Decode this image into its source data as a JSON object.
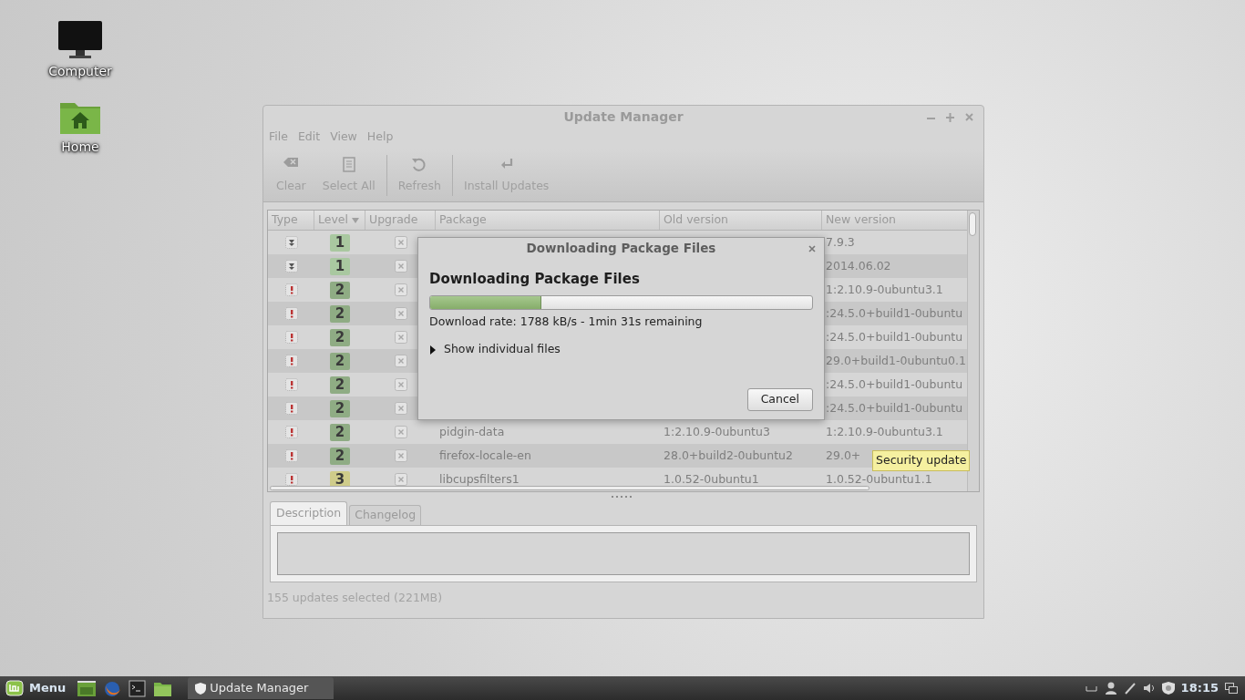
{
  "desktop_icons": [
    {
      "label": "Computer",
      "kind": "computer"
    },
    {
      "label": "Home",
      "kind": "home"
    }
  ],
  "window": {
    "title": "Update Manager"
  },
  "menu": [
    "File",
    "Edit",
    "View",
    "Help"
  ],
  "toolbar": [
    {
      "label": "Clear",
      "kind": "clear"
    },
    {
      "label": "Select All",
      "kind": "select"
    },
    {
      "label": "Refresh",
      "kind": "refresh"
    },
    {
      "label": "Install Updates",
      "kind": "install"
    }
  ],
  "table": {
    "columns": [
      "Type",
      "Level",
      "Upgrade",
      "Package",
      "Old version",
      "New version"
    ],
    "rows": [
      {
        "kind": "package",
        "level": "1",
        "checked": false,
        "new": "7.9.3"
      },
      {
        "kind": "package",
        "level": "1",
        "checked": false,
        "new": "2014.06.02"
      },
      {
        "kind": "security",
        "level": "2",
        "checked": false,
        "new": "1:2.10.9-0ubuntu3.1"
      },
      {
        "kind": "security",
        "level": "2",
        "checked": false,
        "new": ":24.5.0+build1-0ubuntu"
      },
      {
        "kind": "security",
        "level": "2",
        "checked": false,
        "new": ":24.5.0+build1-0ubuntu"
      },
      {
        "kind": "security",
        "level": "2",
        "checked": false,
        "new": "29.0+build1-0ubuntu0.1"
      },
      {
        "kind": "security",
        "level": "2",
        "checked": false,
        "new": ":24.5.0+build1-0ubuntu"
      },
      {
        "kind": "security",
        "level": "2",
        "checked": false,
        "new": ":24.5.0+build1-0ubuntu"
      },
      {
        "kind": "security",
        "level": "2",
        "checked": false,
        "package": "pidgin-data",
        "old": "1:2.10.9-0ubuntu3",
        "new": "1:2.10.9-0ubuntu3.1"
      },
      {
        "kind": "security",
        "level": "2",
        "checked": false,
        "package": "firefox-locale-en",
        "old": "28.0+build2-0ubuntu2",
        "new": "29.0+"
      },
      {
        "kind": "security",
        "level": "3",
        "checked": false,
        "package": "libcupsfilters1",
        "old": "1.0.52-0ubuntu1",
        "new": "1.0.52-0ubuntu1.1"
      }
    ]
  },
  "tooltip": "Security update",
  "tabs": [
    {
      "label": "Description",
      "selected": true
    },
    {
      "label": "Changelog",
      "selected": false
    }
  ],
  "status": "155 updates selected (221MB)",
  "dialog": {
    "title": "Downloading Package Files",
    "heading": "Downloading Package Files",
    "level": 0.29,
    "rate": "Download rate: 1788 kB/s - 1min 31s remaining",
    "expander": {
      "label": "Show individual files",
      "expanded": false
    },
    "button": "Cancel"
  },
  "panel": {
    "menu": "Menu",
    "launchers": [
      {
        "kind": "files"
      },
      {
        "kind": "firefox"
      },
      {
        "kind": "terminal"
      },
      {
        "kind": "folder"
      }
    ],
    "task": "Update Manager",
    "clock": "18:15"
  }
}
